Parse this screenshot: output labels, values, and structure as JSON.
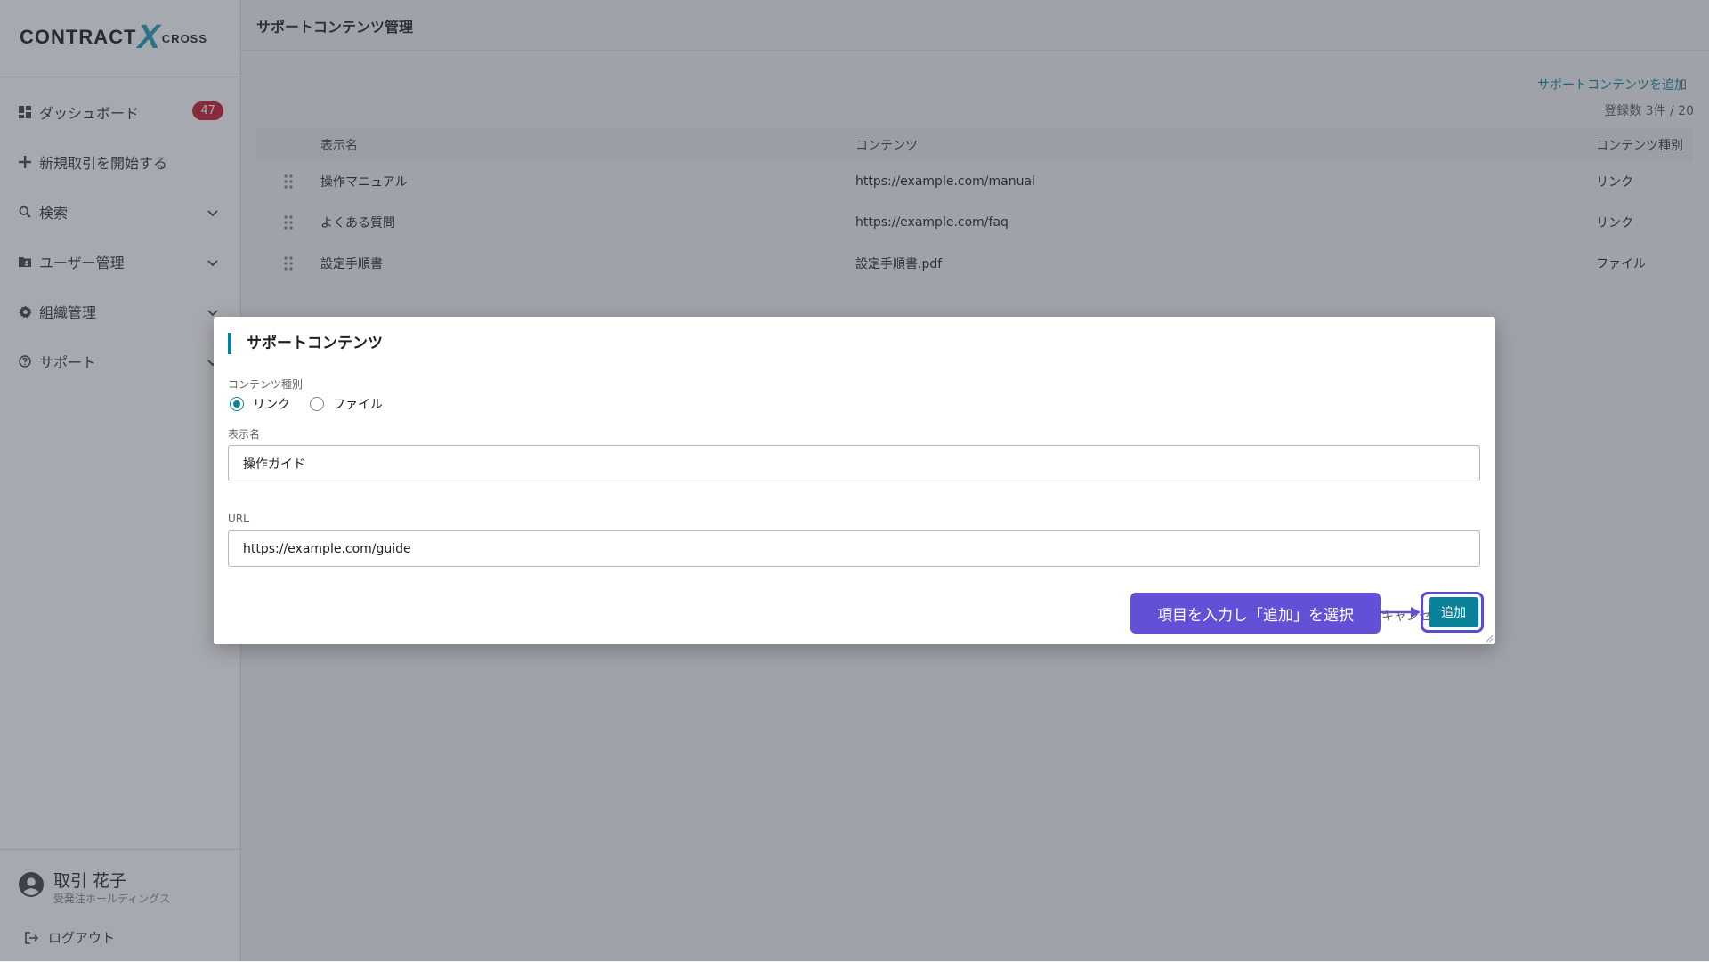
{
  "sidebar": {
    "logo": {
      "word": "CONTRACT",
      "x": "X",
      "cross": "CROSS"
    },
    "items": [
      {
        "label": "ダッシュボード",
        "icon": "dashboard-icon",
        "badge": "47"
      },
      {
        "label": "新規取引を開始する",
        "icon": "plus-icon"
      },
      {
        "label": "検索",
        "icon": "search-icon",
        "expandable": true
      },
      {
        "label": "ユーザー管理",
        "icon": "folder-user-icon",
        "expandable": true
      },
      {
        "label": "組織管理",
        "icon": "gear-icon",
        "expandable": true
      },
      {
        "label": "サポート",
        "icon": "help-circle-icon",
        "expandable": true
      }
    ],
    "user": {
      "name": "取引 花子",
      "org": "受発注ホールディングス"
    },
    "logout_label": "ログアウト"
  },
  "main": {
    "title": "サポートコンテンツ管理",
    "add_link": "サポートコンテンツを追加",
    "count": "登録数 3件 / 20",
    "table": {
      "headers": [
        "表示名",
        "コンテンツ",
        "コンテンツ種別"
      ],
      "rows": [
        {
          "name": "操作マニュアル",
          "content": "https://example.com/manual",
          "type": "リンク"
        },
        {
          "name": "よくある質問",
          "content": "https://example.com/faq",
          "type": "リンク"
        },
        {
          "name": "設定手順書",
          "content": "設定手順書.pdf",
          "type": "ファイル"
        }
      ]
    }
  },
  "modal": {
    "title": "サポートコンテンツ",
    "content_type_label": "コンテンツ種別",
    "radio_link": "リンク",
    "radio_file": "ファイル",
    "selected": "リンク",
    "name_label": "表示名",
    "name_value": "操作ガイド",
    "url_label": "URL",
    "url_value": "https://example.com/guide",
    "cancel_label": "キャンセル",
    "add_label": "追加",
    "callout": "項目を入力し「追加」を選択"
  },
  "colors": {
    "accent": "#0b8199",
    "badge": "#c8152a",
    "callout": "#6251d6"
  }
}
